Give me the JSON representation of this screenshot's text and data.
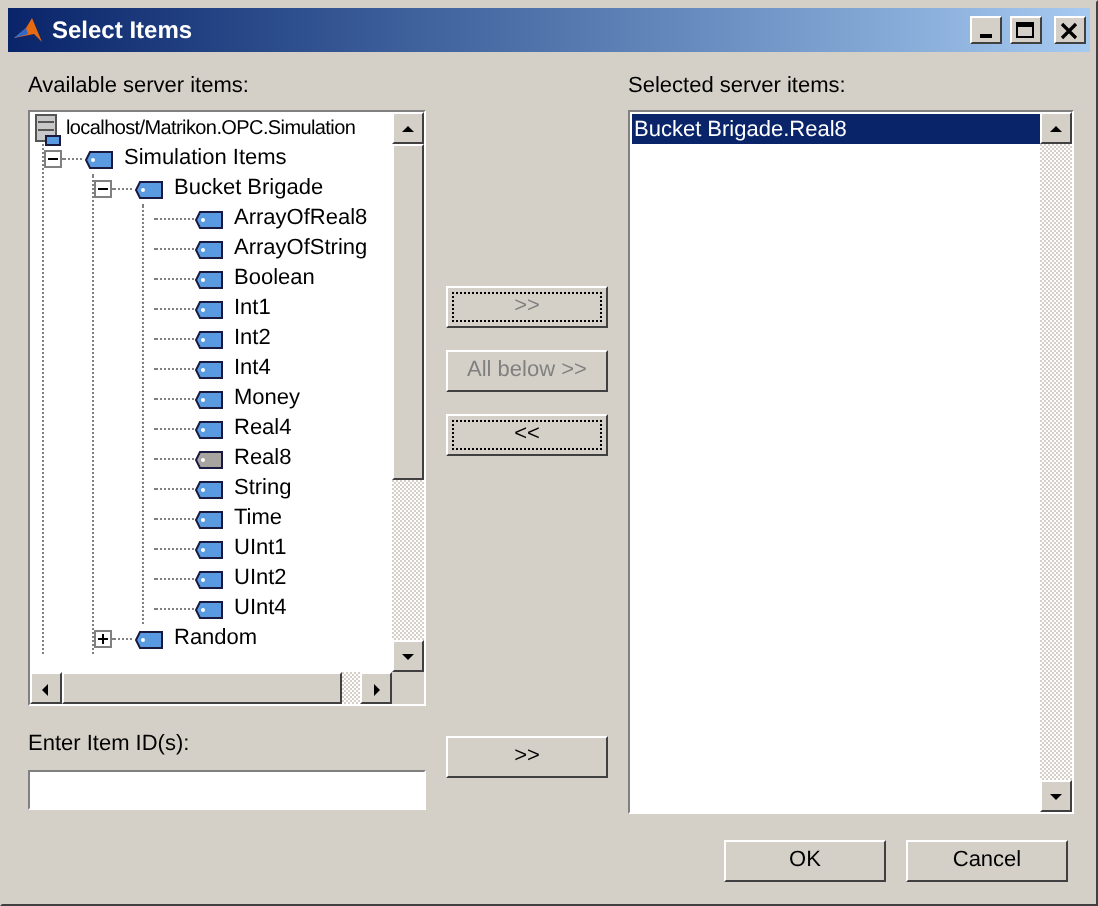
{
  "window": {
    "title": "Select Items"
  },
  "available": {
    "label": "Available server items:",
    "tree": [
      {
        "label": "localhost/Matrikon.OPC.Simulation",
        "kind": "server",
        "children": [
          {
            "label": "Simulation Items",
            "kind": "branch",
            "expanded": true,
            "children": [
              {
                "label": "Bucket Brigade",
                "kind": "branch",
                "expanded": true,
                "children": [
                  {
                    "label": "ArrayOfReal8",
                    "kind": "leaf",
                    "added": false
                  },
                  {
                    "label": "ArrayOfString",
                    "kind": "leaf",
                    "added": false
                  },
                  {
                    "label": "Boolean",
                    "kind": "leaf",
                    "added": false
                  },
                  {
                    "label": "Int1",
                    "kind": "leaf",
                    "added": false
                  },
                  {
                    "label": "Int2",
                    "kind": "leaf",
                    "added": false
                  },
                  {
                    "label": "Int4",
                    "kind": "leaf",
                    "added": false
                  },
                  {
                    "label": "Money",
                    "kind": "leaf",
                    "added": false
                  },
                  {
                    "label": "Real4",
                    "kind": "leaf",
                    "added": false
                  },
                  {
                    "label": "Real8",
                    "kind": "leaf",
                    "added": true
                  },
                  {
                    "label": "String",
                    "kind": "leaf",
                    "added": false
                  },
                  {
                    "label": "Time",
                    "kind": "leaf",
                    "added": false
                  },
                  {
                    "label": "UInt1",
                    "kind": "leaf",
                    "added": false
                  },
                  {
                    "label": "UInt2",
                    "kind": "leaf",
                    "added": false
                  },
                  {
                    "label": "UInt4",
                    "kind": "leaf",
                    "added": false
                  }
                ]
              },
              {
                "label": "Random",
                "kind": "branch",
                "expanded": false
              }
            ]
          }
        ]
      }
    ]
  },
  "item_id": {
    "label": "Enter Item ID(s):"
  },
  "move_buttons": [
    {
      "label": ">>",
      "disabled": true,
      "focused": true
    },
    {
      "label": "All below >>",
      "disabled": true,
      "focused": false
    },
    {
      "label": "<<",
      "disabled": false,
      "focused": true
    }
  ],
  "add_id_button": {
    "label": ">>"
  },
  "selected": {
    "label": "Selected server items:",
    "items": [
      {
        "label": "Bucket Brigade.Real8",
        "selected": true
      }
    ]
  },
  "buttons": [
    "OK",
    "Cancel"
  ]
}
